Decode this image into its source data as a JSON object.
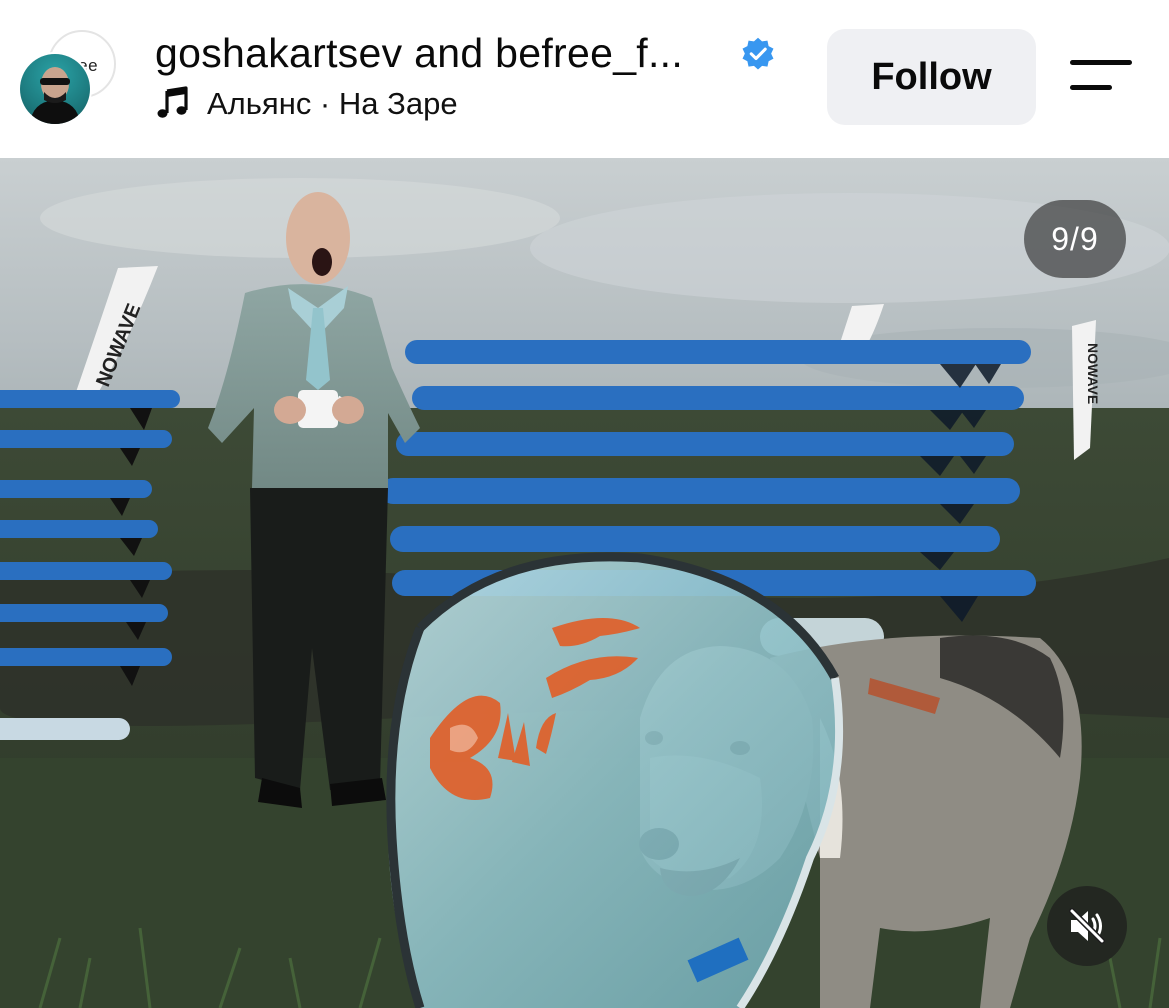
{
  "post_header": {
    "title": "goshakartsev and befree_f...",
    "verified_icon": "verified-badge-icon",
    "audio_icon": "music-note-icon",
    "audio_track": "Альянс · На Заре",
    "follow_label": "Follow",
    "menu_icon": "menu-icon",
    "collab_avatar_text": "ree",
    "verified_color": "#3897f0"
  },
  "media": {
    "counter": "9/9",
    "slide_index": 9,
    "slide_total": 9,
    "mute_icon": "speaker-muted-icon",
    "flag_text_left": "NOWAVE",
    "flag_text_right": "NOWAVE"
  }
}
